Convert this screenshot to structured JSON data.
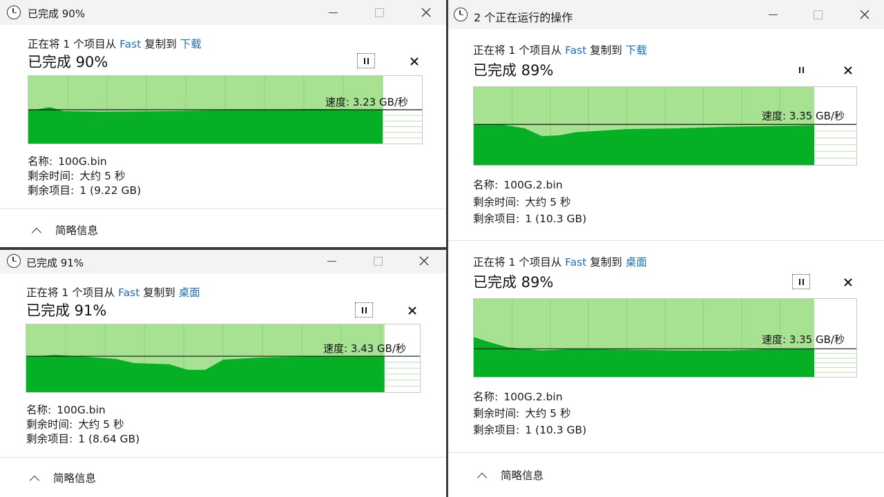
{
  "windows": [
    {
      "title": "已完成 90%",
      "op": {
        "prefix": "正在将 1 个项目从",
        "source": "Fast",
        "mid": "复制到",
        "dest": "下载"
      },
      "percent_text": "已完成 90%",
      "progress": 0.9,
      "speed_text": "速度: 3.23 GB/秒",
      "details": [
        {
          "label": "名称:",
          "value": "100G.bin"
        },
        {
          "label": "剩余时间:",
          "value": "大约 5 秒"
        },
        {
          "label": "剩余项目:",
          "value": "1 (9.22 GB)"
        }
      ],
      "footer": "简略信息"
    },
    {
      "title": "已完成 91%",
      "op": {
        "prefix": "正在将 1 个项目从",
        "source": "Fast",
        "mid": "复制到",
        "dest": "桌面"
      },
      "percent_text": "已完成 91%",
      "progress": 0.91,
      "speed_text": "速度: 3.43 GB/秒",
      "details": [
        {
          "label": "名称:",
          "value": "100G.bin"
        },
        {
          "label": "剩余时间:",
          "value": "大约 5 秒"
        },
        {
          "label": "剩余项目:",
          "value": "1 (8.64 GB)"
        }
      ],
      "footer": "简略信息"
    },
    {
      "title": "2 个正在运行的操作",
      "ops": [
        {
          "op": {
            "prefix": "正在将 1 个项目从",
            "source": "Fast",
            "mid": "复制到",
            "dest": "下载"
          },
          "percent_text": "已完成 89%",
          "progress": 0.89,
          "speed_text": "速度: 3.35 GB/秒",
          "details": [
            {
              "label": "名称:",
              "value": "100G.2.bin"
            },
            {
              "label": "剩余时间:",
              "value": "大约 5 秒"
            },
            {
              "label": "剩余项目:",
              "value": "1 (10.3 GB)"
            }
          ]
        },
        {
          "op": {
            "prefix": "正在将 1 个项目从",
            "source": "Fast",
            "mid": "复制到",
            "dest": "桌面"
          },
          "percent_text": "已完成 89%",
          "progress": 0.89,
          "speed_text": "速度: 3.35 GB/秒",
          "details": [
            {
              "label": "名称:",
              "value": "100G.2.bin"
            },
            {
              "label": "剩余时间:",
              "value": "大约 5 秒"
            },
            {
              "label": "剩余项目:",
              "value": "1 (10.3 GB)"
            }
          ]
        }
      ],
      "footer": "简略信息"
    }
  ],
  "colors": {
    "link": "#1a6fc1",
    "graph_fill_light": "#a6e291",
    "graph_fill_dark": "#06b025",
    "grid": "#8fd07a"
  },
  "icons": {
    "title": "clock-icon",
    "pause": "pause-icon",
    "cancel": "close-icon",
    "footer": "chevron-up-icon"
  }
}
